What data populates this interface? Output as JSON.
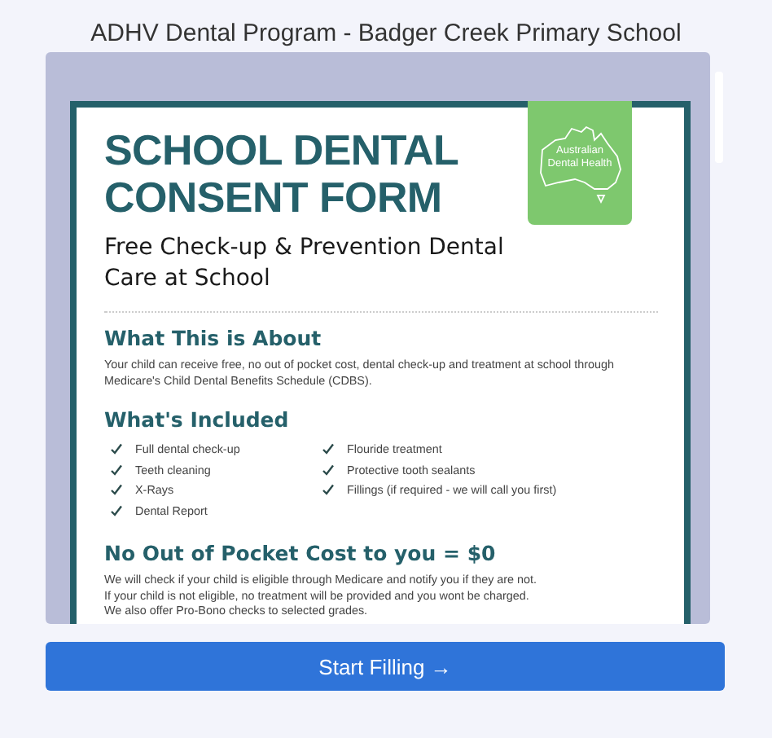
{
  "window": {
    "title": "ADHV Dental Program - Badger Creek Primary School"
  },
  "document": {
    "title_lines": [
      "SCHOOL DENTAL",
      "CONSENT FORM"
    ],
    "logo": {
      "text": "Australian Dental Health"
    },
    "subtitle": "Free Check-up & Prevention Dental Care at School",
    "sections": [
      {
        "kind": "text",
        "heading": "What This is About",
        "body": [
          "Your child can receive free, no out of pocket cost, dental check-up and treatment at school through Medicare's Child Dental Benefits Schedule (CDBS)."
        ]
      },
      {
        "kind": "checklist",
        "heading": "What's Included",
        "items": [
          "Full dental check-up",
          "Teeth cleaning",
          "X-Rays",
          "Dental Report",
          "Flouride treatment",
          "Protective tooth sealants",
          "Fillings (if required - we will call you first)"
        ]
      },
      {
        "kind": "text",
        "heading": "No Out of Pocket Cost to you = $0",
        "body": [
          "We will check if your child is eligible through Medicare and notify you if they are not.",
          "If your child is not eligible, no treatment will be provided and you wont be charged.",
          "We also offer Pro-Bono checks to selected grades."
        ]
      }
    ]
  },
  "button": {
    "label": "Start Filling →"
  }
}
